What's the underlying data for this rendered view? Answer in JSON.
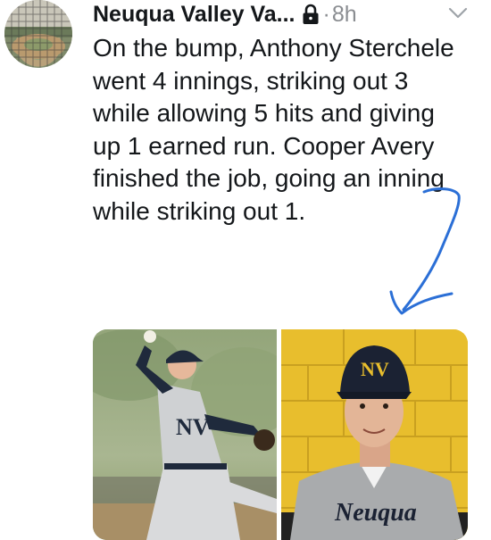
{
  "tweet": {
    "author_name": "Neuqua Valley Va...",
    "separator": "·",
    "timestamp": "8h",
    "text": "On the bump, Anthony Sterchele went 4 innings, striking out 3 while allowing 5 hits and giving up 1 earned run. Cooper Avery finished the job, going an inning while striking out 1.",
    "icons": {
      "protected": "lock-icon",
      "menu": "chevron-down-icon"
    },
    "media": {
      "left_jersey_text": "NV",
      "right_cap_text": "NV",
      "right_jersey_text": "Neuqua"
    }
  },
  "colors": {
    "text": "#14171a",
    "muted": "#8a8d91",
    "annotation": "#2b6fd6",
    "cap_navy": "#1b2233",
    "wall_yellow": "#e8be2d"
  }
}
